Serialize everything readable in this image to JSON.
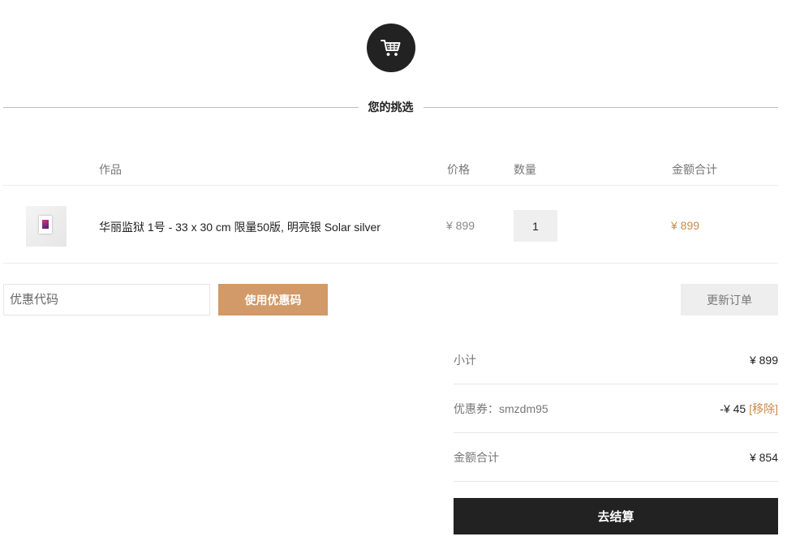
{
  "header": {
    "cart_icon": "cart-icon",
    "section_title": "您的挑选"
  },
  "cart_table": {
    "columns": {
      "product": "作品",
      "price": "价格",
      "quantity": "数量",
      "total": "金额合计"
    },
    "items": [
      {
        "name": "华丽监狱 1号 - 33 x 30 cm 限量50版, 明亮银 Solar silver",
        "price": "¥ 899",
        "quantity": "1",
        "total": "¥ 899"
      }
    ]
  },
  "coupon": {
    "placeholder": "优惠代码",
    "value": "",
    "apply_label": "使用优惠码"
  },
  "update_label": "更新订单",
  "totals": {
    "subtotal_label": "小计",
    "subtotal_value": "¥ 899",
    "coupon_label": "优惠券：smzdm95",
    "coupon_value": "-¥ 45",
    "remove_label": "[移除]",
    "grand_total_label": "金额合计",
    "grand_total_value": "¥ 854"
  },
  "checkout_label": "去结算",
  "colors": {
    "accent": "#d19a68",
    "price_accent": "#c98a4b",
    "dark": "#222222"
  }
}
